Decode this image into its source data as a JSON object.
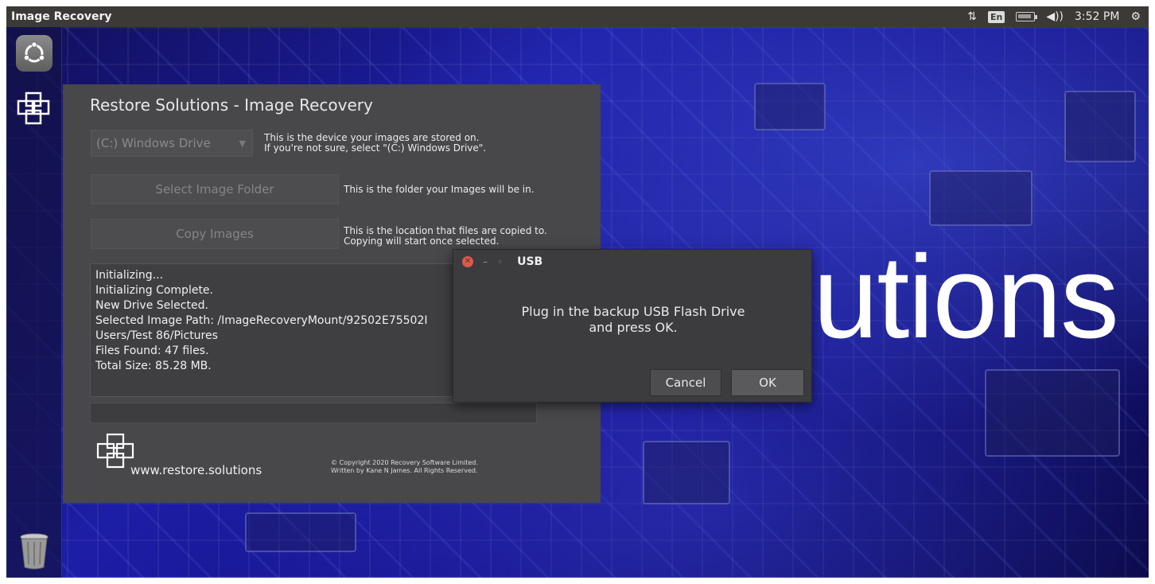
{
  "topbar": {
    "app_title": "Image Recovery",
    "keyboard_layout": "En",
    "clock": "3:52 PM"
  },
  "wallpaper": {
    "text": "utions"
  },
  "main_window": {
    "title": "Restore Solutions - Image Recovery",
    "drive_combo_value": "(C:) Windows Drive",
    "drive_hint_line1": "This is the device your images are stored on.",
    "drive_hint_line2": "If you're not sure, select \"(C:) Windows Drive\".",
    "select_folder_label": "Select Image Folder",
    "select_folder_hint": "This is the folder your Images will be in.",
    "copy_images_label": "Copy Images",
    "copy_hint_line1": "This is the location that files are copied to.",
    "copy_hint_line2": "Copying will start once selected.",
    "log_lines": [
      "Initializing...",
      "Initializing Complete.",
      "New Drive Selected.",
      "Selected Image Path: /ImageRecoveryMount/92502E75502I",
      "Users/Test 86/Pictures",
      "Files Found: 47 files.",
      "Total Size: 85.28 MB."
    ],
    "progress_fraction": 0,
    "website": "www.restore.solutions",
    "copyright_line1": "© Copyright 2020 Recovery Software Limited.",
    "copyright_line2": "Written by Kane N James. All Rights Reserved."
  },
  "dialog": {
    "title": "USB",
    "message_line1": "Plug in the backup USB Flash Drive",
    "message_line2": "and press OK.",
    "cancel_label": "Cancel",
    "ok_label": "OK"
  },
  "colors": {
    "panel": "#3b3a37",
    "window_bg": "#48474a",
    "dialog_bg": "#3c3b3e",
    "wallpaper_blue": "#1c1ea6"
  }
}
